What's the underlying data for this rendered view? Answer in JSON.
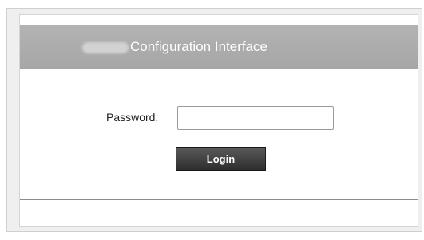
{
  "header": {
    "title": "Configuration Interface"
  },
  "login_form": {
    "password_label": "Password:",
    "password_value": "",
    "login_label": "Login"
  },
  "colors": {
    "header_bg": "#aaaaaa",
    "button_bg": "#3a3a3a",
    "frame_bg": "#efefef"
  }
}
